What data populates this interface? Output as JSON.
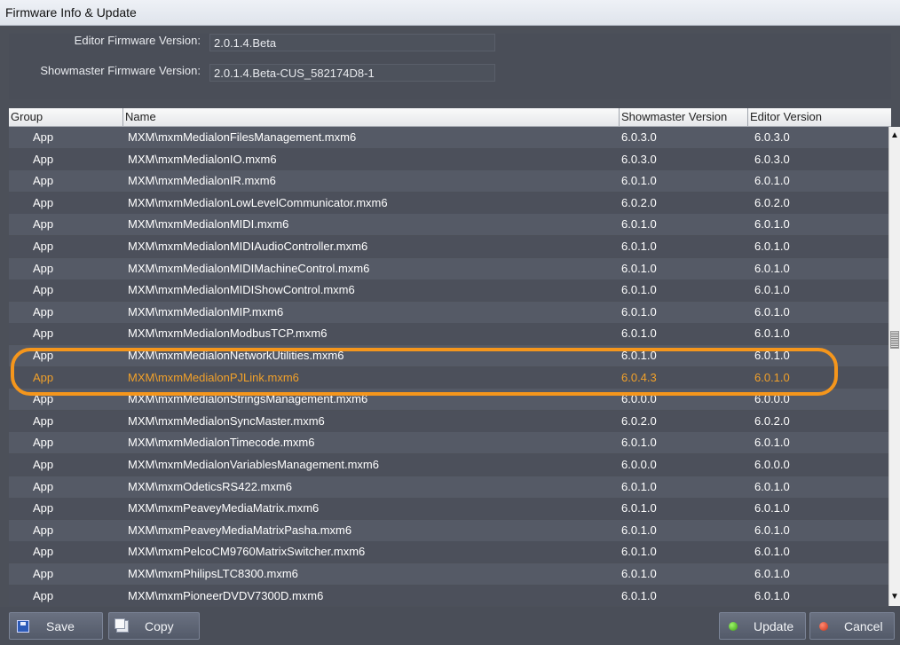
{
  "window": {
    "title": "Firmware Info & Update"
  },
  "info": {
    "editor_label": "Editor Firmware Version:",
    "editor_value": "2.0.1.4.Beta",
    "showmaster_label": "Showmaster Firmware Version:",
    "showmaster_value": "2.0.1.4.Beta-CUS_582174D8-1"
  },
  "table": {
    "columns": [
      "Group",
      "Name",
      "Showmaster Version",
      "Editor Version"
    ],
    "highlighted_row_index": 11,
    "rows": [
      {
        "group": "App",
        "name": "MXM\\mxmMedialonFilesManagement.mxm6",
        "showmaster": "6.0.3.0",
        "editor": "6.0.3.0"
      },
      {
        "group": "App",
        "name": "MXM\\mxmMedialonIO.mxm6",
        "showmaster": "6.0.3.0",
        "editor": "6.0.3.0"
      },
      {
        "group": "App",
        "name": "MXM\\mxmMedialonIR.mxm6",
        "showmaster": "6.0.1.0",
        "editor": "6.0.1.0"
      },
      {
        "group": "App",
        "name": "MXM\\mxmMedialonLowLevelCommunicator.mxm6",
        "showmaster": "6.0.2.0",
        "editor": "6.0.2.0"
      },
      {
        "group": "App",
        "name": "MXM\\mxmMedialonMIDI.mxm6",
        "showmaster": "6.0.1.0",
        "editor": "6.0.1.0"
      },
      {
        "group": "App",
        "name": "MXM\\mxmMedialonMIDIAudioController.mxm6",
        "showmaster": "6.0.1.0",
        "editor": "6.0.1.0"
      },
      {
        "group": "App",
        "name": "MXM\\mxmMedialonMIDIMachineControl.mxm6",
        "showmaster": "6.0.1.0",
        "editor": "6.0.1.0"
      },
      {
        "group": "App",
        "name": "MXM\\mxmMedialonMIDIShowControl.mxm6",
        "showmaster": "6.0.1.0",
        "editor": "6.0.1.0"
      },
      {
        "group": "App",
        "name": "MXM\\mxmMedialonMIP.mxm6",
        "showmaster": "6.0.1.0",
        "editor": "6.0.1.0"
      },
      {
        "group": "App",
        "name": "MXM\\mxmMedialonModbusTCP.mxm6",
        "showmaster": "6.0.1.0",
        "editor": "6.0.1.0"
      },
      {
        "group": "App",
        "name": "MXM\\mxmMedialonNetworkUtilities.mxm6",
        "showmaster": "6.0.1.0",
        "editor": "6.0.1.0"
      },
      {
        "group": "App",
        "name": "MXM\\mxmMedialonPJLink.mxm6",
        "showmaster": "6.0.4.3",
        "editor": "6.0.1.0"
      },
      {
        "group": "App",
        "name": "MXM\\mxmMedialonStringsManagement.mxm6",
        "showmaster": "6.0.0.0",
        "editor": "6.0.0.0"
      },
      {
        "group": "App",
        "name": "MXM\\mxmMedialonSyncMaster.mxm6",
        "showmaster": "6.0.2.0",
        "editor": "6.0.2.0"
      },
      {
        "group": "App",
        "name": "MXM\\mxmMedialonTimecode.mxm6",
        "showmaster": "6.0.1.0",
        "editor": "6.0.1.0"
      },
      {
        "group": "App",
        "name": "MXM\\mxmMedialonVariablesManagement.mxm6",
        "showmaster": "6.0.0.0",
        "editor": "6.0.0.0"
      },
      {
        "group": "App",
        "name": "MXM\\mxmOdeticsRS422.mxm6",
        "showmaster": "6.0.1.0",
        "editor": "6.0.1.0"
      },
      {
        "group": "App",
        "name": "MXM\\mxmPeaveyMediaMatrix.mxm6",
        "showmaster": "6.0.1.0",
        "editor": "6.0.1.0"
      },
      {
        "group": "App",
        "name": "MXM\\mxmPeaveyMediaMatrixPasha.mxm6",
        "showmaster": "6.0.1.0",
        "editor": "6.0.1.0"
      },
      {
        "group": "App",
        "name": "MXM\\mxmPelcoCM9760MatrixSwitcher.mxm6",
        "showmaster": "6.0.1.0",
        "editor": "6.0.1.0"
      },
      {
        "group": "App",
        "name": "MXM\\mxmPhilipsLTC8300.mxm6",
        "showmaster": "6.0.1.0",
        "editor": "6.0.1.0"
      },
      {
        "group": "App",
        "name": "MXM\\mxmPioneerDVDV7300D.mxm6",
        "showmaster": "6.0.1.0",
        "editor": "6.0.1.0"
      }
    ]
  },
  "buttons": {
    "save": {
      "label": "Save",
      "icon": "floppy-disk-icon"
    },
    "copy": {
      "label": "Copy",
      "icon": "copy-icon"
    },
    "update": {
      "label": "Update",
      "icon": "green-dot-icon"
    },
    "cancel": {
      "label": "Cancel",
      "icon": "red-dot-icon"
    }
  },
  "colors": {
    "highlight_ring": "#f5961c",
    "highlight_text": "#f2a12a"
  }
}
